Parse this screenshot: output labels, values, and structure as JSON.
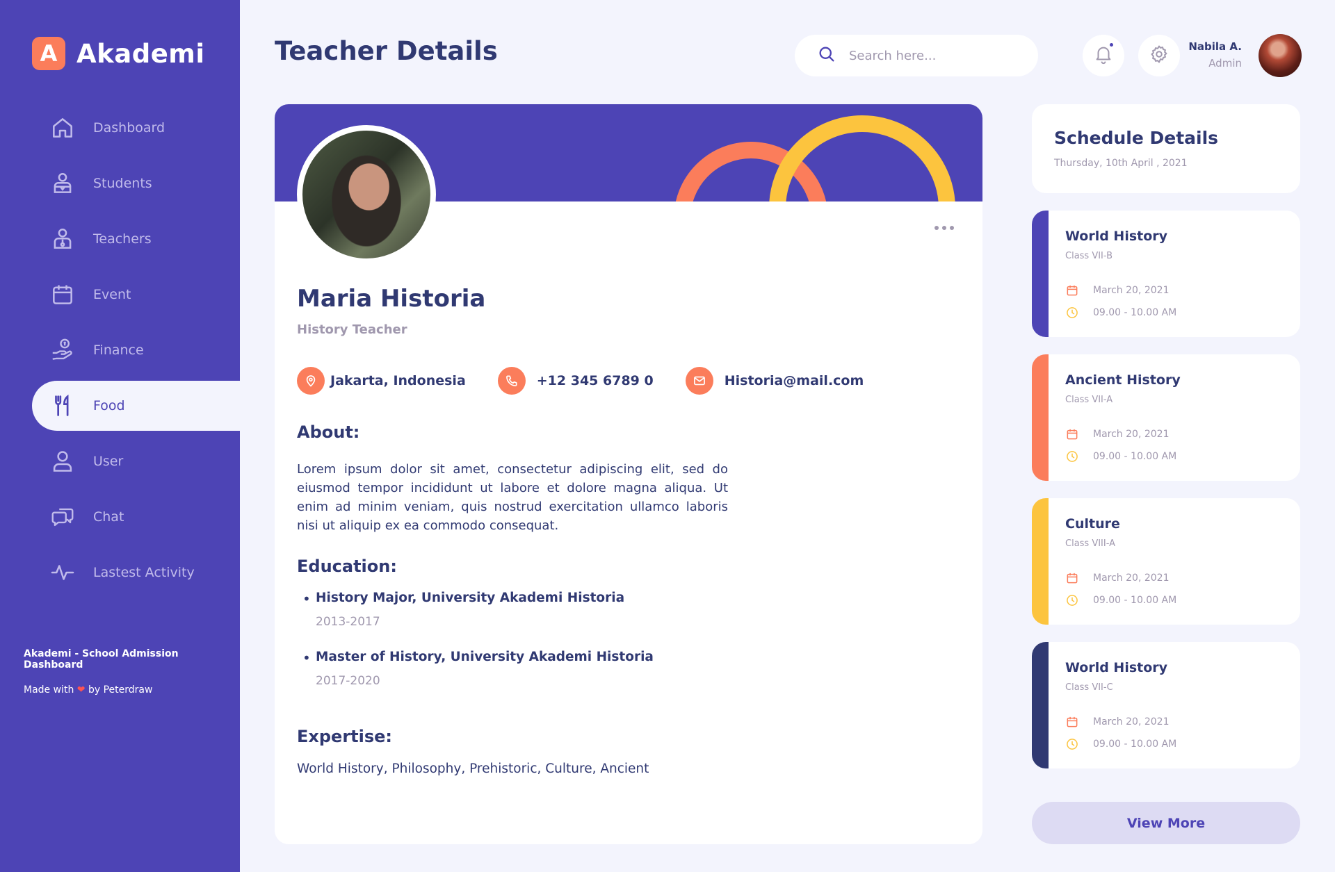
{
  "app": {
    "logo_letter": "A",
    "name": "Akademi"
  },
  "sidebar": {
    "items": [
      {
        "label": "Dashboard",
        "icon": "home-icon"
      },
      {
        "label": "Students",
        "icon": "student-icon"
      },
      {
        "label": "Teachers",
        "icon": "teacher-icon"
      },
      {
        "label": "Event",
        "icon": "calendar-icon"
      },
      {
        "label": "Finance",
        "icon": "finance-icon"
      },
      {
        "label": "Food",
        "icon": "food-icon",
        "active": true
      },
      {
        "label": "User",
        "icon": "user-icon"
      },
      {
        "label": "Chat",
        "icon": "chat-icon"
      },
      {
        "label": "Lastest Activity",
        "icon": "activity-icon"
      }
    ],
    "footer_title": "Akademi - School Admission Dashboard",
    "footer_made_prefix": "Made with",
    "footer_made_suffix": "by Peterdraw"
  },
  "header": {
    "title": "Teacher Details",
    "search_placeholder": "Search here...",
    "user_name": "Nabila A.",
    "user_role": "Admin"
  },
  "teacher": {
    "name": "Maria Historia",
    "role": "History Teacher",
    "location": "Jakarta, Indonesia",
    "phone": "+12 345 6789 0",
    "email": "Historia@mail.com",
    "about_heading": "About:",
    "about": "Lorem ipsum dolor sit amet, consectetur adipiscing elit, sed do eiusmod tempor incididunt ut labore et dolore magna aliqua. Ut enim ad minim veniam, quis nostrud exercitation ullamco laboris nisi ut aliquip ex ea commodo consequat.",
    "education_heading": "Education:",
    "education": [
      {
        "degree": "History Major, University Akademi Historia",
        "years": "2013-2017"
      },
      {
        "degree": "Master of History, University Akademi Historia",
        "years": "2017-2020"
      }
    ],
    "expertise_heading": "Expertise:",
    "expertise": "World History, Philosophy, Prehistoric, Culture, Ancient"
  },
  "schedule": {
    "title": "Schedule Details",
    "date": "Thursday, 10th April , 2021",
    "items": [
      {
        "title": "World History",
        "class": "Class VII-B",
        "date": "March 20, 2021",
        "time": "09.00 - 10.00 AM",
        "color": "#4D44B5"
      },
      {
        "title": "Ancient History",
        "class": "Class VII-A",
        "date": "March 20, 2021",
        "time": "09.00 - 10.00 AM",
        "color": "#FB7D5B"
      },
      {
        "title": "Culture",
        "class": "Class VIII-A",
        "date": "March 20, 2021",
        "time": "09.00 - 10.00 AM",
        "color": "#FCC43E"
      },
      {
        "title": "World History",
        "class": "Class VII-C",
        "date": "March 20, 2021",
        "time": "09.00 - 10.00 AM",
        "color": "#303972"
      }
    ],
    "view_more": "View More"
  },
  "colors": {
    "primary": "#4D44B5",
    "orange": "#FB7D5B",
    "yellow": "#FCC43E",
    "navy": "#303972",
    "muted": "#A098AE",
    "background": "#F3F4FD"
  }
}
